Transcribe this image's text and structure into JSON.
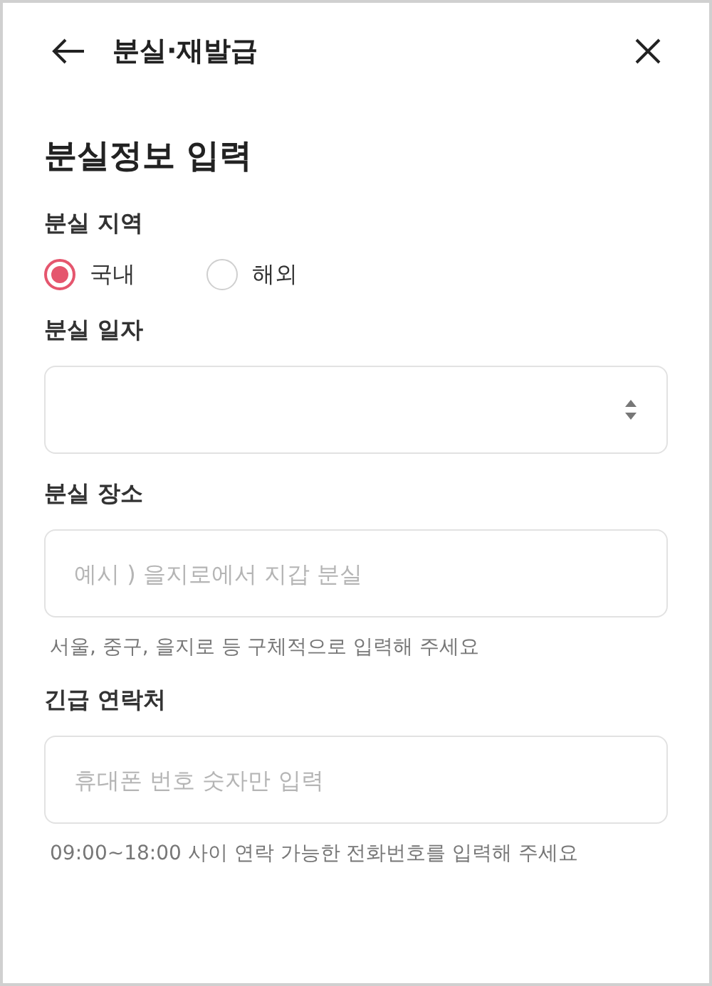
{
  "header": {
    "title": "분실·재발급"
  },
  "section_title": "분실정보 입력",
  "fields": [
    {
      "kind": "radio",
      "label": "분실 지역",
      "options": [
        {
          "label": "국내",
          "selected": true
        },
        {
          "label": "해외",
          "selected": false
        }
      ]
    },
    {
      "kind": "select",
      "label": "분실 일자"
    },
    {
      "kind": "text",
      "label": "분실 장소",
      "placeholder": "예시 ) 을지로에서 지갑 분실",
      "hint": "서울, 중구, 을지로 등 구체적으로 입력해 주세요"
    },
    {
      "kind": "text",
      "label": "긴급 연락처",
      "placeholder": "휴대폰 번호 숫자만 입력",
      "hint": "09:00~18:00 사이 연락 가능한 전화번호를 입력해 주세요"
    }
  ]
}
